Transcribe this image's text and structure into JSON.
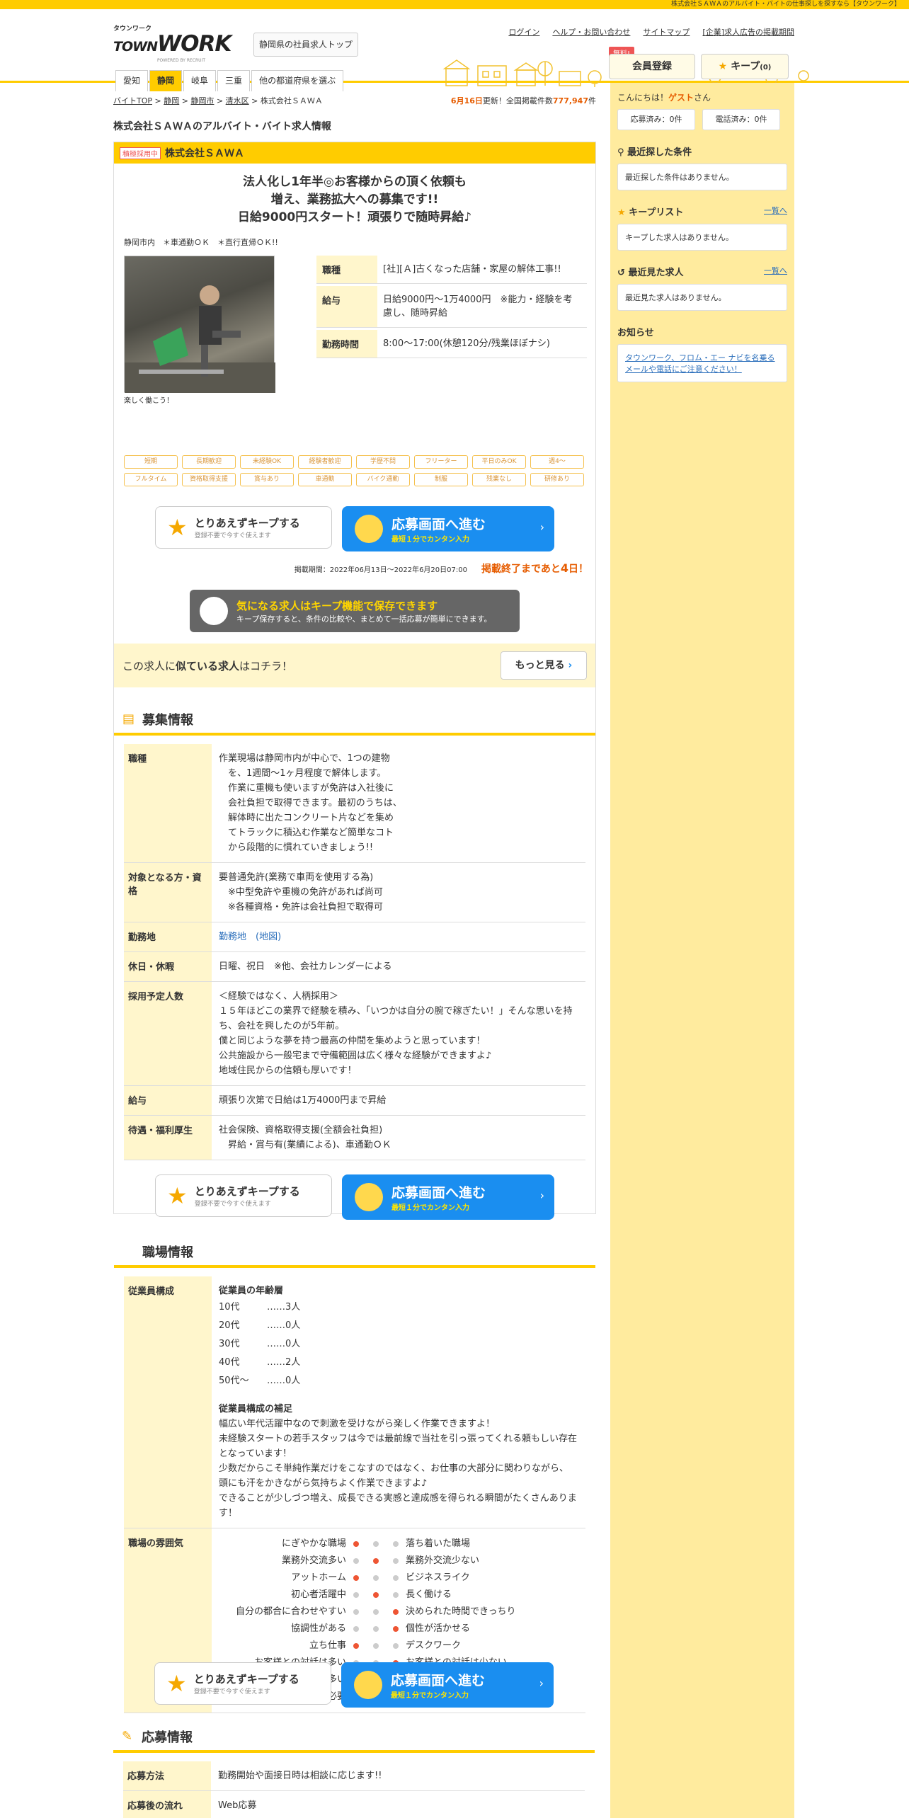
{
  "topbar": {
    "text": "株式会社ＳＡＷＡのアルバイト・バイトの仕事探しを探すなら【タウンワーク】"
  },
  "header": {
    "logo_kana": "タウンワーク",
    "logo_town": "TOWN",
    "logo_work": "WORK",
    "logo_recruit": "POWERED BY RECRUIT",
    "pref_top": "静岡県の社員求人トップ",
    "pref_tabs": [
      "愛知",
      "静岡",
      "岐阜",
      "三重",
      "他の都道府県を選ぶ"
    ],
    "links": [
      "ログイン",
      "ヘルプ・お問い合わせ",
      "サイトマップ",
      "[企業]求人広告の掲載期間"
    ],
    "free": "無料!",
    "register": "会員登録",
    "keep": "キープ",
    "keep_count": "(0)"
  },
  "breadcrumb": {
    "items": [
      "バイトTOP",
      "静岡",
      "静岡市",
      "清水区",
      "株式会社ＳＡＷＡ"
    ],
    "date": "6月16日",
    "updated": "更新！全国掲載件数",
    "count": "777,947",
    "unit": "件"
  },
  "page_title": "株式会社ＳＡＷＡのアルバイト・バイト求人情報",
  "job": {
    "badge": "積極採用中",
    "company": "株式会社ＳＡＷＡ",
    "catch": [
      "法人化し1年半◎お客様からの頂く依頼も",
      "増え、業務拡大への募集です!!",
      "日給9000円スタート！頑張りで随時昇給♪"
    ],
    "location": "静岡市内　＊車通勤ＯＫ　＊直行直帰ＯＫ!!",
    "caption": "楽しく働こう！",
    "summary": [
      {
        "k": "職種",
        "v": "[社][Ａ]古くなった店舗・家屋の解体工事!!"
      },
      {
        "k": "給与",
        "v": "日給9000円～1万4000円　※能力・経験を考慮し、随時昇給"
      },
      {
        "k": "勤務時間",
        "v": "8:00～17:00(休憩120分/残業ほぼナシ)"
      }
    ],
    "tags": [
      "短期",
      "長期歓迎",
      "未経験OK",
      "経験者歓迎",
      "学歴不問",
      "フリーター",
      "平日のみOK",
      "週4～",
      "フルタイム",
      "資格取得支援",
      "賞与あり",
      "車通勤",
      "バイク通勤",
      "制服",
      "残業なし",
      "研修あり"
    ]
  },
  "buttons": {
    "keep_t1": "とりあえずキープする",
    "keep_t2": "登録不要で今すぐ使えます",
    "apply_t1": "応募画面へ進む",
    "apply_t2": "最短１分でカンタン入力"
  },
  "period": {
    "text": "掲載期間：2022年06月13日～2022年6月20日07:00",
    "end_prefix": "掲載終了まであと",
    "end_days": "4",
    "end_suffix": "日！"
  },
  "info": {
    "t1": "気になる求人はキープ機能で保存できます",
    "t2": "キープ保存すると、条件の比較や、まとめて一括応募が簡単にできます。"
  },
  "similar": {
    "pre": "この求人に",
    "bold": "似ている求人",
    "post": "はコチラ！",
    "more": "もっと見る"
  },
  "recruit": {
    "title": "募集情報",
    "rows": [
      {
        "k": "職種",
        "v": "作業現場は静岡市内が中心で、1つの建物\n　を、1週間～1ヶ月程度で解体します。\n　作業に重機も使いますが免許は入社後に\n　会社負担で取得できます。最初のうちは、\n　解体時に出たコンクリート片などを集め\n　てトラックに積込む作業など簡単なコト\n　から段階的に慣れていきましょう!!"
      },
      {
        "k": "対象となる方・資格",
        "v": "要普通免許(業務で車両を使用する為)\n　※中型免許や重機の免許があれば尚可\n　※各種資格・免許は会社負担で取得可"
      },
      {
        "k": "勤務地",
        "v": "勤務地　(地図)"
      },
      {
        "k": "休日・休暇",
        "v": "日曜、祝日　※他、会社カレンダーによる"
      },
      {
        "k": "採用予定人数",
        "v": "＜経験ではなく、人柄採用＞\n１５年ほどこの業界で経験を積み、「いつかは自分の腕で稼ぎたい！」そんな思いを持ち、会社を興したのが5年前。\n僕と同じような夢を持つ最高の仲間を集めようと思っています！\n公共施設から一般宅まで守備範囲は広く様々な経験ができますよ♪\n地域住民からの信頼も厚いです！"
      },
      {
        "k": "給与",
        "v": "頑張り次第で日給は1万4000円まで昇給"
      },
      {
        "k": "待遇・福利厚生",
        "v": "社会保険、資格取得支援(全額会社負担)\n　昇給・賞与有(業績による)、車通勤ＯＫ"
      }
    ]
  },
  "workplace": {
    "title": "職場情報",
    "k1": "従業員構成",
    "age_title": "従業員の年齢層",
    "ages": [
      {
        "a": "10代",
        "n": "……3人"
      },
      {
        "a": "20代",
        "n": "……0人"
      },
      {
        "a": "30代",
        "n": "……0人"
      },
      {
        "a": "40代",
        "n": "……2人"
      },
      {
        "a": "50代～",
        "n": "……0人"
      }
    ],
    "supp_title": "従業員構成の補足",
    "supp": "幅広い年代活躍中なので刺激を受けながら楽しく作業できますよ！\n未経験スタートの若手スタッフは今では最前線で当社を引っ張ってくれる頼もしい存在となっています！\n少数だからこそ単純作業だけをこなすのではなく、お仕事の大部分に関わりながら、\n頭にも汗をかきながら気持ちよく作業できますよ♪\nできることが少しづつ増え、成長できる実感と達成感を得られる瞬間がたくさんあります！",
    "k2": "職場の雰囲気",
    "moods": [
      {
        "l": "にぎやかな職場",
        "r": "落ち着いた職場",
        "p": 0
      },
      {
        "l": "業務外交流多い",
        "r": "業務外交流少ない",
        "p": 1
      },
      {
        "l": "アットホーム",
        "r": "ビジネスライク",
        "p": 0
      },
      {
        "l": "初心者活躍中",
        "r": "長く働ける",
        "p": 1
      },
      {
        "l": "自分の都合に合わせやすい",
        "r": "決められた時間できっちり",
        "p": 2
      },
      {
        "l": "協調性がある",
        "r": "個性が活かせる",
        "p": 2
      },
      {
        "l": "立ち仕事",
        "r": "デスクワーク",
        "p": 0
      },
      {
        "l": "お客様との対話は多い",
        "r": "お客様との対話は少ない",
        "p": 2
      },
      {
        "l": "力仕事が多い",
        "r": "力仕事が少ない",
        "p": 0
      },
      {
        "l": "知識、経験必要",
        "r": "知識、経験不要",
        "p": 1
      }
    ]
  },
  "apply": {
    "title": "応募情報",
    "rows": [
      {
        "k": "応募方法",
        "v": "勤務開始や面接日時は相談に応じます!!"
      },
      {
        "k": "応募後の流れ",
        "v": "Web応募"
      }
    ]
  },
  "side": {
    "hello": "こんにちは！",
    "guest": "ゲスト",
    "san": "さん",
    "applied": "応募済み：0件",
    "called": "電話済み：0件",
    "recent_cond": "最近探した条件",
    "recent_cond_empty": "最近探した条件はありません。",
    "keeplist": "キープリスト",
    "list_link": "一覧へ",
    "keeplist_empty": "キープした求人はありません。",
    "recent_viewed": "最近見た求人",
    "recent_viewed_empty": "最近見た求人はありません。",
    "notice": "お知らせ",
    "notice_text": "タウンワーク、フロム・エー ナビを名乗るメールや電話にご注意ください！"
  },
  "colors": {
    "brand": "#ffcc00",
    "accent": "#e65c00",
    "apply": "#1a8ef0"
  }
}
